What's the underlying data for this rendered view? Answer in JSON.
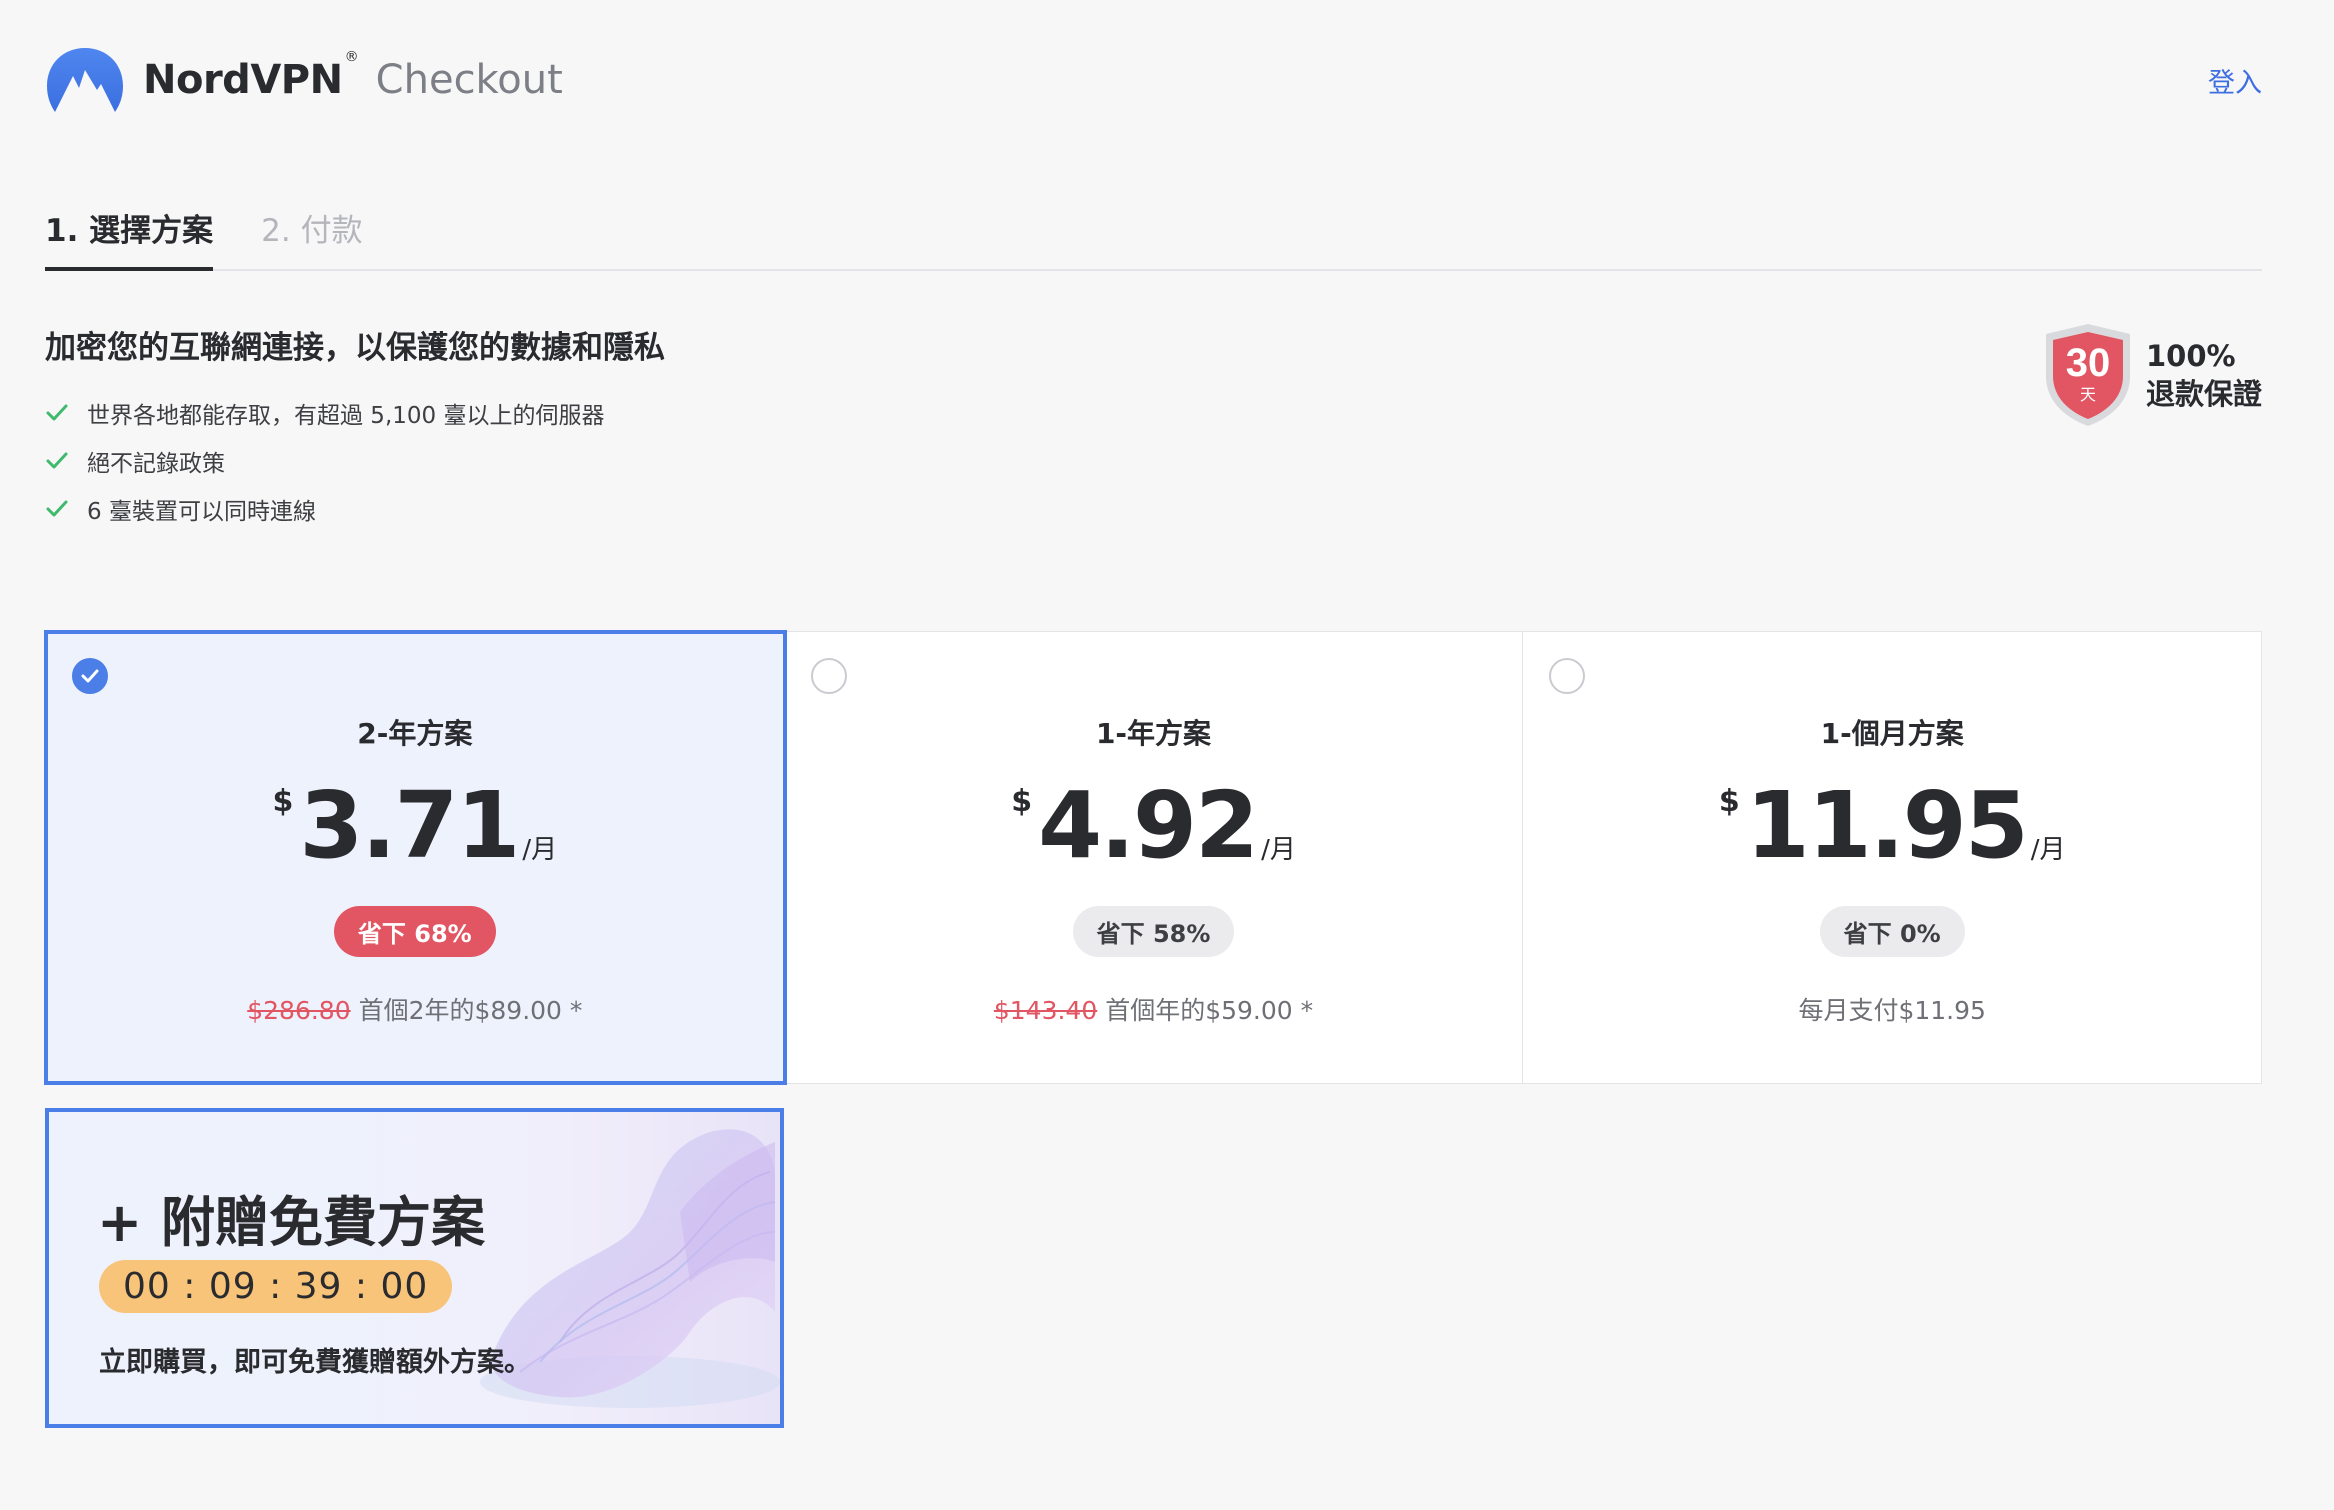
{
  "header": {
    "brand_name": "NordVPN",
    "brand_reg": "®",
    "brand_sub": "Checkout",
    "login_label": "登入"
  },
  "steps": [
    {
      "label": "1. 選擇方案",
      "active": true
    },
    {
      "label": "2. 付款",
      "active": false
    }
  ],
  "features": {
    "title": "加密您的互聯網連接，以保護您的數據和隱私",
    "items": [
      "世界各地都能存取，有超過 5,100 臺以上的伺服器",
      "絕不記錄政策",
      "6 臺裝置可以同時連線"
    ]
  },
  "guarantee": {
    "days": "30",
    "day_unit": "天",
    "line1": "100%",
    "line2": "退款保證"
  },
  "plans": [
    {
      "name": "2-年方案",
      "currency": "$",
      "amount": "3.71",
      "per": "/月",
      "save": "省下 68%",
      "original": "$286.80",
      "billing": "首個2年的$89.00 *",
      "selected": true
    },
    {
      "name": "1-年方案",
      "currency": "$",
      "amount": "4.92",
      "per": "/月",
      "save": "省下 58%",
      "original": "$143.40",
      "billing": "首個年的$59.00 *",
      "selected": false
    },
    {
      "name": "1-個月方案",
      "currency": "$",
      "amount": "11.95",
      "per": "/月",
      "save": "省下 0%",
      "original": "",
      "billing": "每月支付$11.95",
      "selected": false
    }
  ],
  "promo": {
    "title": "+ 附贈免費方案",
    "countdown": "00 : 09 : 39 : 00",
    "description": "立即購買，即可免費獲贈額外方案。"
  },
  "colors": {
    "accent": "#4c7ee8",
    "link": "#3e6fe0",
    "badge_red": "#e25563",
    "check_green": "#3fb96b",
    "countdown_bg": "#f7c47a"
  }
}
